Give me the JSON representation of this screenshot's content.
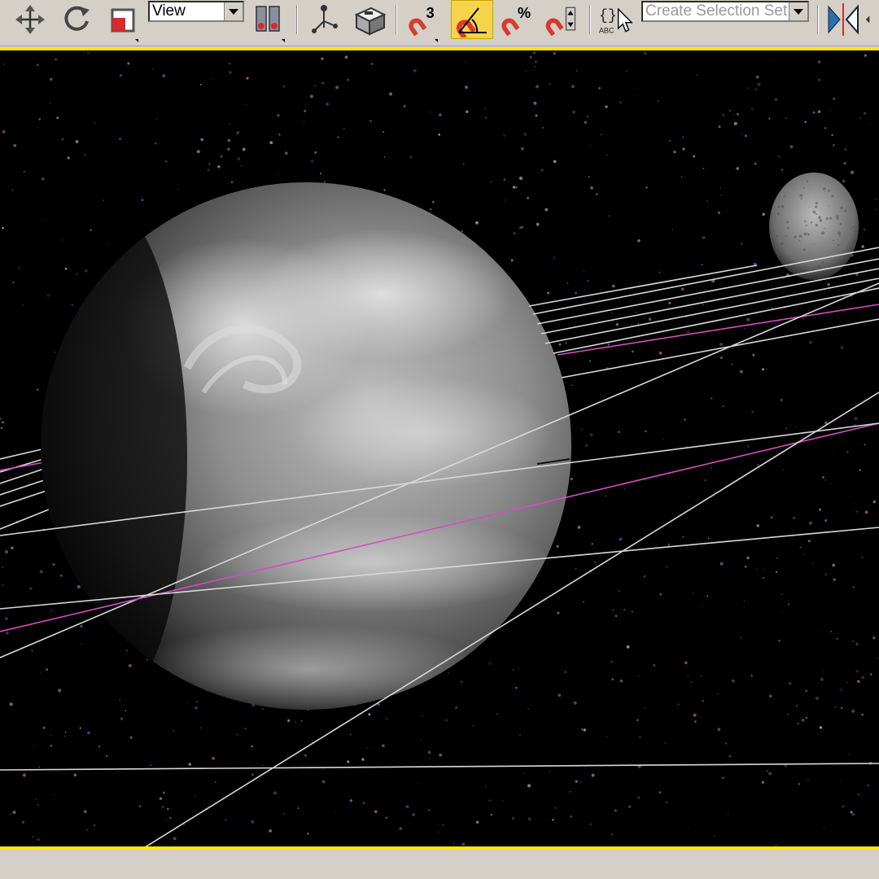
{
  "toolbar": {
    "reference_coordinate_system": {
      "selected": "View"
    },
    "named_selection_set": {
      "placeholder": "Create Selection Set"
    },
    "tools": [
      {
        "name": "select-and-move",
        "icon": "move-icon"
      },
      {
        "name": "select-and-rotate",
        "icon": "rotate-icon"
      },
      {
        "name": "select-and-scale",
        "icon": "scale-icon"
      },
      {
        "name": "use-pivot-point-center",
        "icon": "pivot-center-icon"
      },
      {
        "name": "select-and-manipulate",
        "icon": "manipulate-icon"
      },
      {
        "name": "keyboard-shortcut-override",
        "icon": "shortcut-override-icon"
      },
      {
        "name": "snaps-toggle",
        "icon": "snap-3d-icon",
        "label": "3"
      },
      {
        "name": "angle-snap-toggle",
        "icon": "angle-snap-icon",
        "active": true
      },
      {
        "name": "percent-snap-toggle",
        "icon": "percent-snap-icon",
        "label": "%"
      },
      {
        "name": "spinner-snap-toggle",
        "icon": "spinner-snap-icon"
      },
      {
        "name": "edit-named-selection-sets",
        "icon": "named-selection-icon",
        "label": "ABC"
      },
      {
        "name": "mirror",
        "icon": "mirror-icon"
      },
      {
        "name": "align",
        "icon": "align-icon"
      }
    ]
  },
  "viewport": {
    "border_color": "#ffe600",
    "background": "#000000",
    "objects": [
      "earth-planet",
      "moon",
      "orbit-paths",
      "star-field"
    ],
    "orbit_colors": {
      "selected": "#d24fc0",
      "normal": "#d8d8d8"
    }
  }
}
